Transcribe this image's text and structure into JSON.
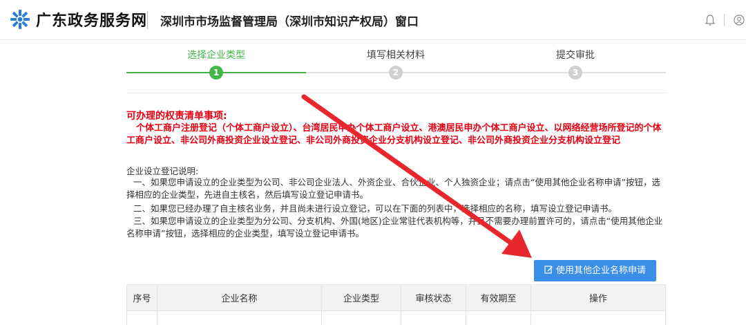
{
  "header": {
    "brand": "广东政务服务网",
    "department": "深圳市市场监督管理局（深圳市知识产权局）窗口"
  },
  "steps": [
    {
      "label": "选择企业类型",
      "num": "1"
    },
    {
      "label": "填写相关材料",
      "num": "2"
    },
    {
      "label": "提交审批",
      "num": "3"
    }
  ],
  "notice": {
    "title": "可办理的权责清单事项:",
    "body": "个体工商户注册登记（个体工商户设立）、台湾居民申办个体工商户设立、港澳居民申办个体工商户设立、以网络经营场所登记的个体工商户设立、非公司外商投资企业设立登记、非公司外商投资企业分支机构设立登记、非公司外商投资企业分支机构设立登记"
  },
  "instructions": {
    "title": "企业设立登记说明:",
    "item1": "一、如果您申请设立的企业类型为公司、非公司企业法人、外资企业、合伙企业、个人独资企业；请点击“使用其他企业名称申请”按钮，选择相应的企业类型，先进自主核名，然后填写设立登记申请书。",
    "item2": "二、如果您已经办理了自主核名业务，并且尚未进行设立登记，可以在下面的列表中，选择相应的名称，填写设立登记申请书。",
    "item3": "三、如果您申请设立的企业类型为分公司、分支机构、外国(地区)企业常驻代表机构等，并且不需要办理前置许可的，请点击“使用其他企业名称申请”按钮，选择相应的企业类型，填写设立登记申请书。"
  },
  "apply_button": "使用其他企业名称申请",
  "table": {
    "headers": [
      "序号",
      "企业名称",
      "企业类型",
      "审核状态",
      "有效期至",
      "操作"
    ]
  },
  "colors": {
    "active_step": "#44b549",
    "inactive_step": "#d0d0d0",
    "notice_red": "#e60012",
    "button_blue": "#3a8ee6",
    "arrow_red": "#e8262d"
  }
}
